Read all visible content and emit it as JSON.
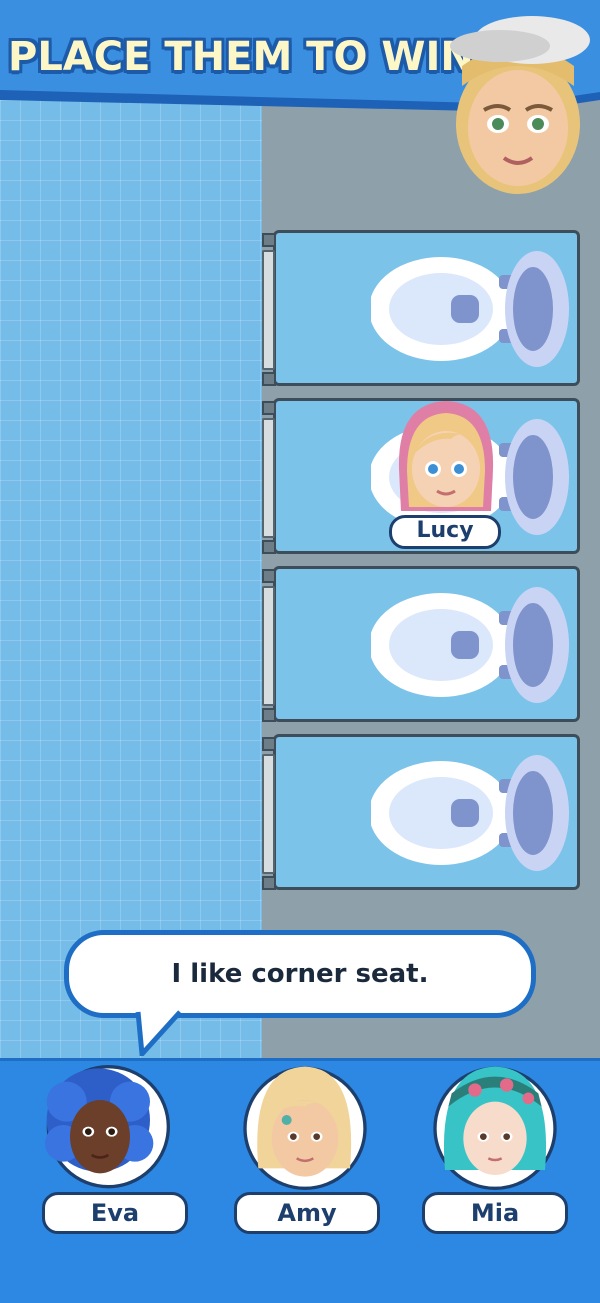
{
  "header": {
    "title": "PLACE THEM TO WIN!"
  },
  "stalls": [
    {
      "occupant": ""
    },
    {
      "occupant": "Lucy"
    },
    {
      "occupant": ""
    },
    {
      "occupant": ""
    }
  ],
  "bubble": {
    "text": "I like corner seat."
  },
  "characters": [
    {
      "name": "Eva"
    },
    {
      "name": "Amy"
    },
    {
      "name": "Mia"
    }
  ],
  "colors": {
    "floor": "#75bce8",
    "tray": "#2d88e3",
    "banner": "#3b8fe0",
    "outline": "#1d3f6e"
  }
}
